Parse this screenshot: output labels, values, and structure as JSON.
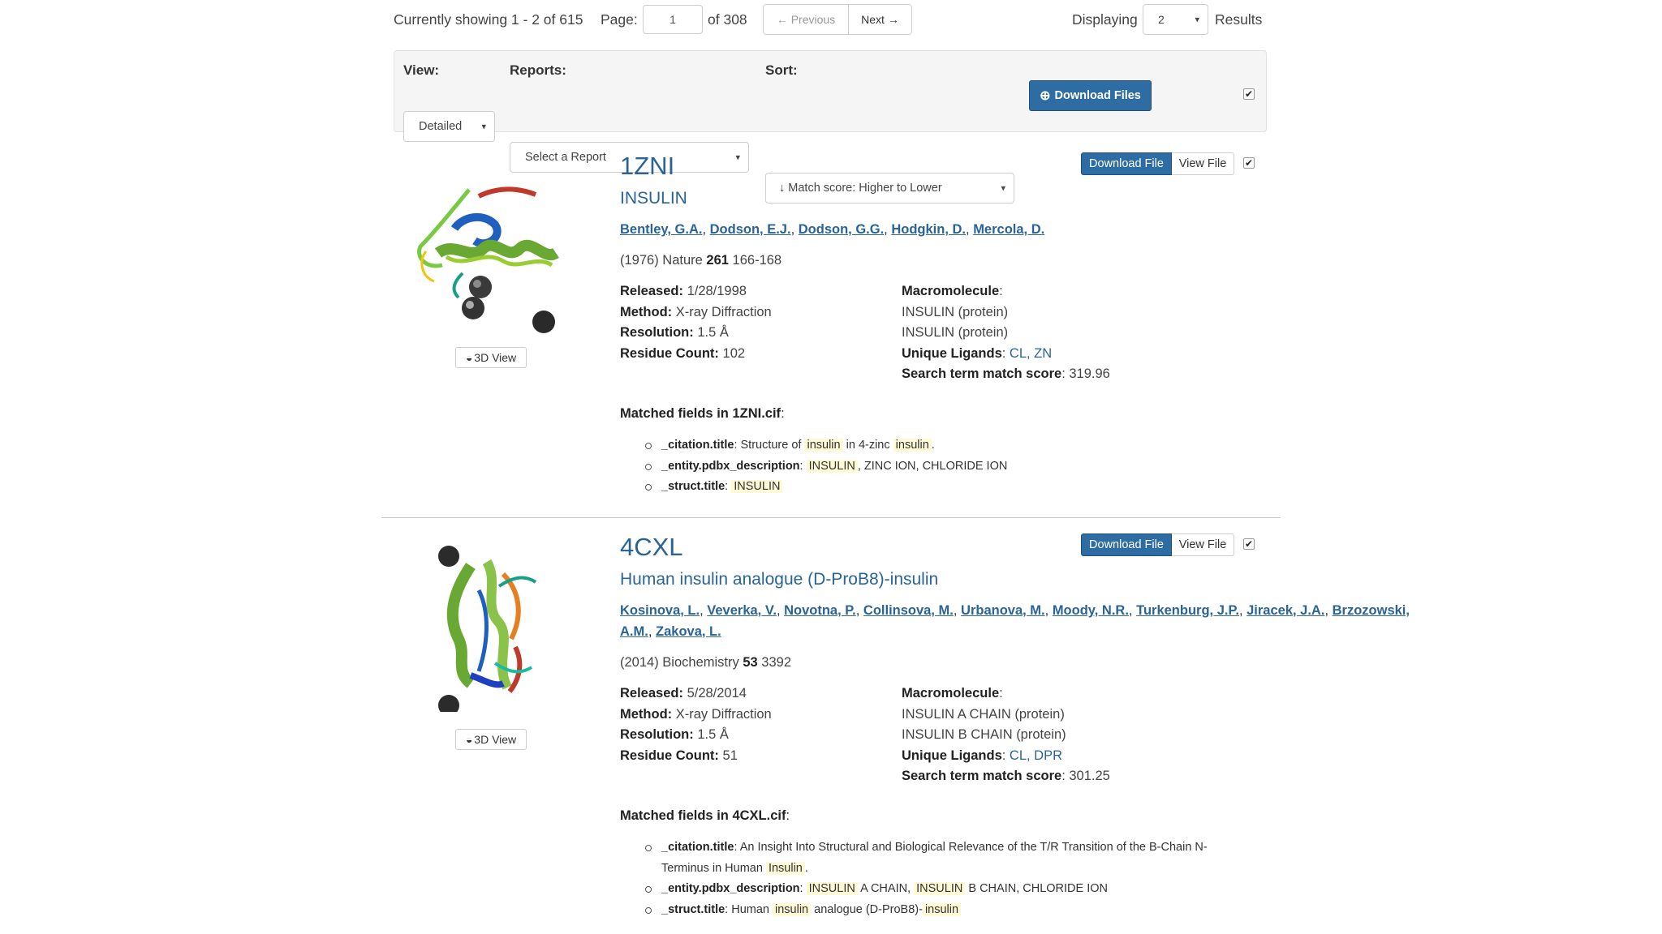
{
  "pagination": {
    "showing_text": "Currently showing 1 - 2 of 615",
    "page_label": "Page:",
    "page_value": "1",
    "of_text": "of 308",
    "previous_label": "← Previous",
    "next_label": "Next →",
    "displaying_label": "Displaying",
    "per_page_value": "2",
    "results_label": "Results"
  },
  "controls": {
    "view_label": "View:",
    "view_value": "Detailed",
    "reports_label": "Reports:",
    "reports_value": "Select a Report",
    "sort_label": "Sort:",
    "sort_value": "↓ Match score: Higher to Lower",
    "download_files_label": "Download Files",
    "select_all_checked": true
  },
  "results": [
    {
      "pdb_id": "1ZNI",
      "title": "INSULIN",
      "authors": [
        "Bentley, G.A.",
        "Dodson, E.J.",
        "Dodson, G.G.",
        "Hodgkin, D.",
        "Mercola, D."
      ],
      "citation": {
        "year": "(1976)",
        "journal": "Nature",
        "volume": "261",
        "pages": "166-168"
      },
      "released_label": "Released:",
      "released": "1/28/1998",
      "method_label": "Method:",
      "method": "X-ray Diffraction",
      "resolution_label": "Resolution:",
      "resolution": "1.5 Å",
      "residue_label": "Residue Count:",
      "residue_count": "102",
      "macromolecule_label": "Macromolecule",
      "macromolecules": [
        "INSULIN (protein)",
        "INSULIN (protein)"
      ],
      "ligands_label": "Unique Ligands",
      "ligands": "CL, ZN",
      "score_label": "Search term match score",
      "score": "319.96",
      "matched_prefix": "Matched fields in",
      "matched_file": "1ZNI.cif",
      "download_label": "Download File",
      "view_label": "View File",
      "view3d_label": "3D View",
      "checked": true
    },
    {
      "pdb_id": "4CXL",
      "title": "Human insulin analogue (D-ProB8)-insulin",
      "authors": [
        "Kosinova, L.",
        "Veverka, V.",
        "Novotna, P.",
        "Collinsova, M.",
        "Urbanova, M.",
        "Moody, N.R.",
        "Turkenburg, J.P.",
        "Jiracek, J.A.",
        "Brzozowski, A.M.",
        "Zakova, L."
      ],
      "citation": {
        "year": "(2014)",
        "journal": "Biochemistry",
        "volume": "53",
        "pages": "3392"
      },
      "released_label": "Released:",
      "released": "5/28/2014",
      "method_label": "Method:",
      "method": "X-ray Diffraction",
      "resolution_label": "Resolution:",
      "resolution": "1.5 Å",
      "residue_label": "Residue Count:",
      "residue_count": "51",
      "macromolecule_label": "Macromolecule",
      "macromolecules": [
        "INSULIN A CHAIN (protein)",
        "INSULIN B CHAIN (protein)"
      ],
      "ligands_label": "Unique Ligands",
      "ligands": "CL, DPR",
      "score_label": "Search term match score",
      "score": "301.25",
      "matched_prefix": "Matched fields in",
      "matched_file": "4CXL.cif",
      "download_label": "Download File",
      "view_label": "View File",
      "view3d_label": "3D View",
      "checked": true
    }
  ],
  "matched_fields_1": {
    "citation_key": "_citation.title",
    "citation_pre": "Structure of",
    "citation_hl1": "insulin",
    "citation_mid": "in 4-zinc",
    "citation_hl2": "insulin",
    "citation_post": ".",
    "entity_key": "_entity.pdbx_description",
    "entity_hl": "INSULIN",
    "entity_post": ", ZINC ION, CHLORIDE ION",
    "struct_key": "_struct.title",
    "struct_hl": "INSULIN"
  },
  "matched_fields_2": {
    "citation_key": "_citation.title",
    "citation_pre": "An Insight Into Structural and Biological Relevance of the T/R Transition of the B-Chain N-Terminus in Human",
    "citation_hl": "Insulin",
    "citation_post": ".",
    "entity_key": "_entity.pdbx_description",
    "entity_hl1": "INSULIN",
    "entity_mid": "A CHAIN,",
    "entity_hl2": "INSULIN",
    "entity_post": "B CHAIN, CHLORIDE ION",
    "struct_key": "_struct.title",
    "struct_pre": "Human",
    "struct_hl1": "insulin",
    "struct_mid": "analogue (D-ProB8)-",
    "struct_hl2": "insulin"
  },
  "icons": {
    "checkbox_mark": "✔",
    "download_circle": "⊕",
    "view3d": "◒",
    "caret": "▾"
  },
  "colors": {
    "link": "#2a6496",
    "primary_button": "#2e6da4",
    "highlight": "#fff9d6",
    "panel_bg": "#f5f5f5"
  }
}
